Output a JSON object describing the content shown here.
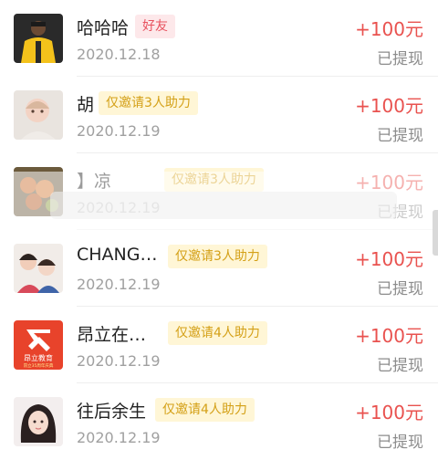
{
  "rows": [
    {
      "name": "哈哈哈",
      "tag": "好友",
      "tag_type": "friend",
      "date": "2020.12.18",
      "amount": "+100元",
      "status": "已提现",
      "avatar": "yellow-jacket-avatar"
    },
    {
      "name": "胡",
      "tag": "仅邀请3人助力",
      "tag_type": "invite",
      "date": "2020.12.19",
      "amount": "+100元",
      "status": "已提现",
      "avatar": "baby-avatar"
    },
    {
      "name": "】凉",
      "tag": "仅邀请3人助力",
      "tag_type": "invite",
      "date": "2020.12.19",
      "amount": "+100元",
      "status": "已提现",
      "avatar": "fruit-avatar"
    },
    {
      "name": "CHANG…",
      "tag": "仅邀请3人助力",
      "tag_type": "invite",
      "date": "2020.12.19",
      "amount": "+100元",
      "status": "已提现",
      "avatar": "family-avatar"
    },
    {
      "name": "昂立在…",
      "tag": "仅邀请4人助力",
      "tag_type": "invite",
      "date": "2020.12.19",
      "amount": "+100元",
      "status": "已提现",
      "avatar": "angli-logo-avatar"
    },
    {
      "name": "往后余生",
      "tag": "仅邀请4人助力",
      "tag_type": "invite",
      "date": "2020.12.19",
      "amount": "+100元",
      "status": "已提现",
      "avatar": "girl-avatar"
    }
  ],
  "logo_text": {
    "line1": "昂立教育",
    "line2": "昂立35周年庆典"
  },
  "colors": {
    "amount": "#e9524f",
    "friend_tag_bg": "#fde8ea",
    "invite_tag_bg": "#fff6d6",
    "invite_tag_text": "#d4a017"
  }
}
